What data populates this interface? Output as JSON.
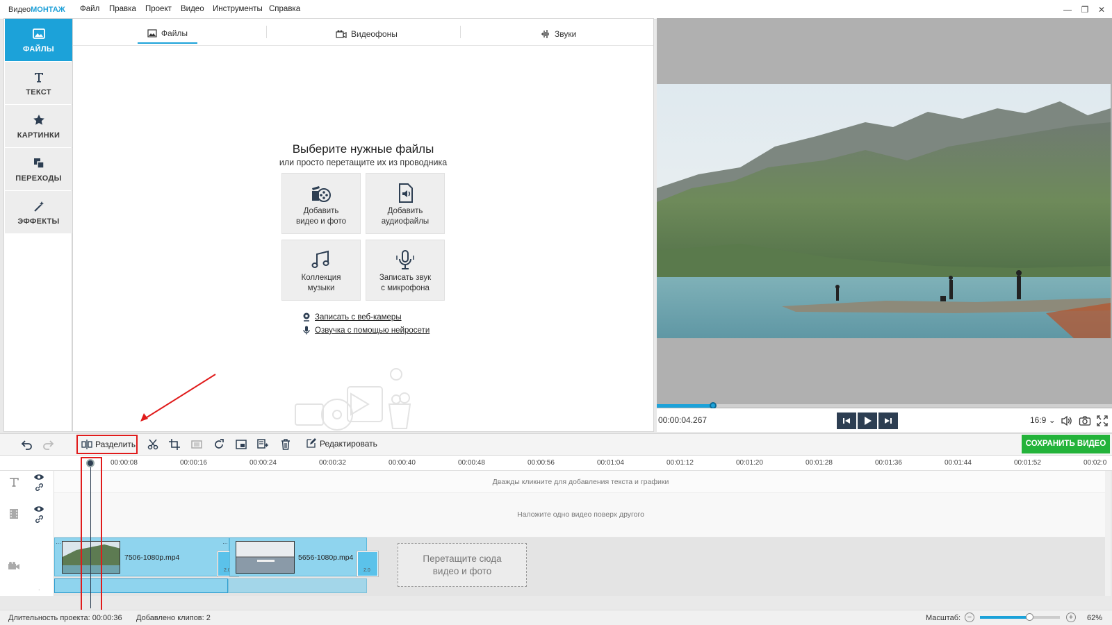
{
  "app": {
    "title_prefix": "Видео",
    "title_brand": "МОНТАЖ"
  },
  "menu": [
    "Файл",
    "Правка",
    "Проект",
    "Видео",
    "Инструменты",
    "Справка"
  ],
  "window_controls": {
    "minimize": "—",
    "restore": "❐",
    "close": "✕"
  },
  "sidebar": {
    "items": [
      {
        "label": "ФАЙЛЫ",
        "icon": "files-icon",
        "active": true
      },
      {
        "label": "ТЕКСТ",
        "icon": "text-icon"
      },
      {
        "label": "КАРТИНКИ",
        "icon": "star-icon"
      },
      {
        "label": "ПЕРЕХОДЫ",
        "icon": "transitions-icon"
      },
      {
        "label": "ЭФФЕКТЫ",
        "icon": "magic-wand-icon"
      }
    ]
  },
  "tabs": [
    {
      "label": "Файлы",
      "icon": "image-icon",
      "active": true
    },
    {
      "label": "Видеофоны",
      "icon": "video-background-icon"
    },
    {
      "label": "Звуки",
      "icon": "waveform-icon"
    }
  ],
  "main": {
    "title": "Выберите нужные файлы",
    "subtitle": "или просто перетащите их из проводника",
    "tiles": [
      {
        "line1": "Добавить",
        "line2": "видео и фото",
        "icon": "film-reel-icon"
      },
      {
        "line1": "Добавить",
        "line2": "аудиофайлы",
        "icon": "audio-file-icon"
      },
      {
        "line1": "Коллекция",
        "line2": "музыки",
        "icon": "music-notes-icon"
      },
      {
        "line1": "Записать звук",
        "line2": "с микрофона",
        "icon": "microphone-icon"
      }
    ],
    "links": [
      {
        "label": "Записать с веб-камеры",
        "icon": "webcam-icon"
      },
      {
        "label": "Озвучка с помощью нейросети",
        "icon": "microphone-icon"
      }
    ]
  },
  "player": {
    "timecode": "00:00:04.267",
    "progress": 0.124,
    "aspect_ratio": "16:9",
    "ratio_chevron": "⌄"
  },
  "toolbar": {
    "split_label": "Разделить",
    "edit_label": "Редактировать",
    "save_label": "СОХРАНИТЬ ВИДЕО"
  },
  "ruler": {
    "ticks": [
      "00:00:08",
      "00:00:16",
      "00:00:24",
      "00:00:32",
      "00:00:40",
      "00:00:48",
      "00:00:56",
      "00:01:04",
      "00:01:12",
      "00:01:20",
      "00:01:28",
      "00:01:36",
      "00:01:44",
      "00:01:52",
      "00:02:0"
    ]
  },
  "timeline": {
    "text_hint": "Дважды кликните для добавления текста и графики",
    "overlay_hint": "Наложите одно видео поверх другого",
    "clips": [
      {
        "name": "7506-1080p.mp4"
      },
      {
        "name": "5656-1080p.mp4"
      }
    ],
    "transition_label": "2.0",
    "drop_zone_line1": "Перетащите сюда",
    "drop_zone_line2": "видео и фото",
    "mark_left": "…",
    "mark_right": "…",
    "row_dot": "."
  },
  "status": {
    "duration_label": "Длительность проекта:",
    "duration_value": "00:00:36",
    "clips_added_label": "Добавлено клипов:",
    "clips_added_value": "2",
    "zoom_label": "Масштаб:",
    "zoom_minus": "−",
    "zoom_plus": "+",
    "zoom_value": "62%",
    "zoom_fraction": 0.62
  },
  "colors": {
    "accent": "#1ca2d9",
    "save": "#23b33a",
    "highlight": "#e01b1b",
    "player_buttons": "#2d3e52"
  }
}
